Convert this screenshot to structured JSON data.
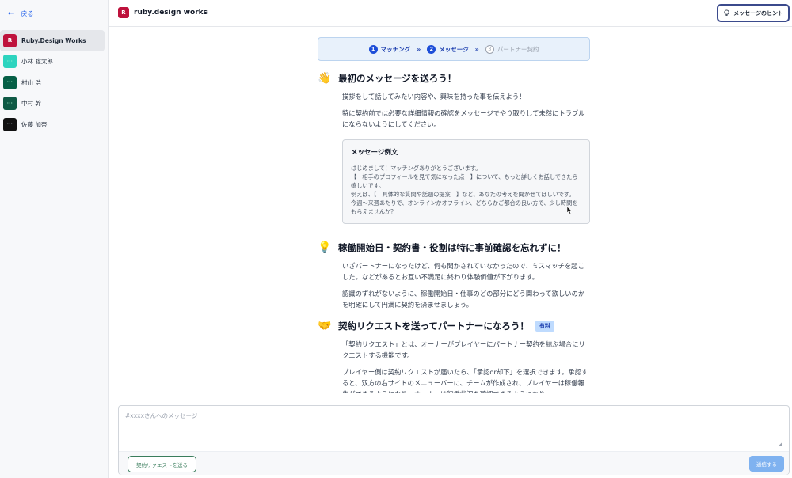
{
  "sidebar": {
    "back_label": "戻る",
    "items": [
      {
        "label": "Ruby.Design Works",
        "avatar_letter": "R",
        "avatar_color": "#be123c",
        "active": true
      },
      {
        "label": "小林 聡太郎",
        "avatar_letter": "",
        "avatar_color": "#2dd4bf",
        "active": false
      },
      {
        "label": "村山 浩",
        "avatar_letter": "",
        "avatar_color": "#065f46",
        "active": false
      },
      {
        "label": "中村 幹",
        "avatar_letter": "",
        "avatar_color": "#0f5a45",
        "active": false
      },
      {
        "label": "佐藤 加奈",
        "avatar_letter": "",
        "avatar_color": "#111111",
        "active": false
      }
    ]
  },
  "header": {
    "brand_letter": "R",
    "brand_name": "ruby.design works",
    "hint_button": "メッセージのヒント"
  },
  "steps": [
    {
      "num": "1",
      "label": "マッチング",
      "state": "done"
    },
    {
      "num": "2",
      "label": "メッセージ",
      "state": "current"
    },
    {
      "num": "3",
      "label": "パートナー契約",
      "state": "inactive"
    }
  ],
  "sections": {
    "first_message": {
      "emoji": "👋",
      "title": "最初のメッセージを送ろう！",
      "para1": "挨拶をして話してみたい内容や、興味を持った事を伝えよう！",
      "para2": "特に契約前では必要な詳細情報の確認をメッセージでやり取りして未然にトラブルにならないようにしてください。",
      "example": {
        "title": "メッセージ例文",
        "lines": [
          "はじめまして！マッチングありがとうございます。",
          "【　相手のプロフィールを見て気になった点　】について、もっと詳しくお話しできたら嬉しいです。",
          "例えば、【　具体的な質問や話題の提案　】など、あなたの考えを聞かせてほしいです。",
          "今週〜来週あたりで、オンラインかオフライン、どちらかご都合の良い方で、少し時間をもらえませんか？"
        ]
      }
    },
    "confirm": {
      "emoji": "💡",
      "title": "稼働開始日・契約書・役割は特に事前確認を忘れずに！",
      "para1": "いざパートナーになったけど、何も聞かされていなかったので、ミスマッチを起こした。などがあるとお互い不満足に終わり体験価値が下がります。",
      "para2": "認識のずれがないように、稼働開始日・仕事のどの部分にどう関わって欲しいのかを明確にして円満に契約を済ませましょう。"
    },
    "contract": {
      "emoji": "🤝",
      "title": "契約リクエストを送ってパートナーになろう！",
      "badge": "有料",
      "para1": "「契約リクエスト」とは、オーナーがプレイヤーにパートナー契約を結ぶ場合にリクエストする機能です。",
      "para2": "プレイヤー側は契約リクエストが届いたら、「承認or却下」を選択できます。承認すると、双方の右サイドのメニューバーに、チームが作成され、プレイヤーは稼働報告ができるようになり、オーナーは稼働状況を確認できるようになり"
    }
  },
  "composer": {
    "placeholder": "#xxxxさんへのメッセージ",
    "contract_button": "契約リクエストを送る",
    "send_button": "送信する"
  }
}
